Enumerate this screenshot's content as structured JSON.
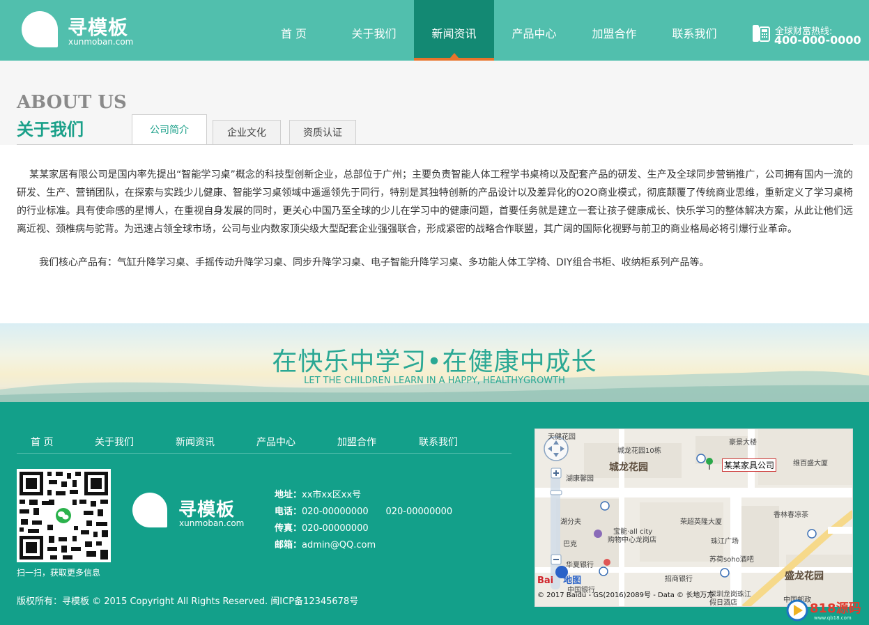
{
  "header": {
    "logo_cn": "寻模板",
    "logo_en": "xunmoban.com",
    "nav": [
      "首 页",
      "关于我们",
      "新闻资讯",
      "产品中心",
      "加盟合作",
      "联系我们"
    ],
    "active_nav": 2,
    "hotline_label": "全球财富热线:",
    "hotline_number": "400-000-0000"
  },
  "about": {
    "title_en": "ABOUT US",
    "title_cn": "关于我们",
    "tabs": [
      "公司简介",
      "企业文化",
      "资质认证"
    ],
    "intro": "某某家居有限公司是国内率先提出“智能学习桌”概念的科技型创新企业，总部位于广州；主要负责智能人体工程学书桌椅以及配套产品的研发、生产及全球同步营销推广，公司拥有国内一流的研发、生产、营销团队，在探索与实践少儿健康、智能学习桌领域中遥遥领先于同行，特别是其独特创新的产品设计以及差异化的O2O商业模式，彻底颠覆了传统商业思维，重新定义了学习桌椅的行业标准。具有使命感的星博人，在重视自身发展的同时，更关心中国乃至全球的少儿在学习中的健康问题，首要任务就是建立一套让孩子健康成长、快乐学习的整体解决方案，从此让他们远离近视、颈椎病与驼背。为迅速占领全球市场，公司与业内数家顶尖级大型配套企业强强联合，形成紧密的战略合作联盟，其广阔的国际化视野与前卫的商业格局必将引爆行业革命。",
    "products": "我们核心产品有：气缸升降学习桌、手摇传动升降学习桌、同步升降学习桌、电子智能升降学习桌、多功能人体工学椅、DIY组合书柜、收纳柜系列产品等。"
  },
  "banner": {
    "slogan_cn": "在快乐中学习•在健康中成长",
    "slogan_en": "LET THE CHILDREN LEARN IN A HAPPY, HEALTHYGROWTH"
  },
  "footer": {
    "nav": [
      "首 页",
      "关于我们",
      "新闻资讯",
      "产品中心",
      "加盟合作",
      "联系我们"
    ],
    "qr_caption": "扫一扫，获取更多信息",
    "logo_cn": "寻模板",
    "logo_en": "xunmoban.com",
    "address_label": "地址：",
    "address": "xx市xx区xx号",
    "phone_label": "电话：",
    "phone": "020-00000000      020-00000000",
    "fax_label": "传真：",
    "fax": "020-00000000",
    "email_label": "邮箱：",
    "email": "admin@QQ.com",
    "copyright": "版权所有：寻模板 © 2015 Copyright  All Rights Reserved. 闽ICP备12345678号"
  },
  "map": {
    "marker_label": "某某家具公司",
    "labels": [
      "天健花园",
      "城龙花园10栋",
      "豪景大楼",
      "城龙花园",
      "维百盛大厦",
      "湖康馨园",
      "宝能·all city",
      "购物中心龙岗店",
      "荣超英隆大厦",
      "香林春凉茶",
      "珠江广场",
      "苏荷soho酒吧",
      "华夏银行",
      "招商银行",
      "盛龙花园",
      "中国银行",
      "中国邮政",
      "深圳龙岗珠江",
      "假日酒店",
      "巴克",
      "湖分夫"
    ],
    "copyright": "© 2017 Baidu - GS(2016)2089号 - Data © 长地万方",
    "brand": "Bai",
    "brand_suffix": "地图"
  },
  "watermark": {
    "text": "818源码",
    "sub": "www.qb18.com"
  },
  "colors": {
    "header_bg": "#51bfad",
    "nav_active_bg": "#138973",
    "nav_active_line": "#e8742c",
    "footer_bg": "#13a08a",
    "accent": "#1aa089"
  }
}
